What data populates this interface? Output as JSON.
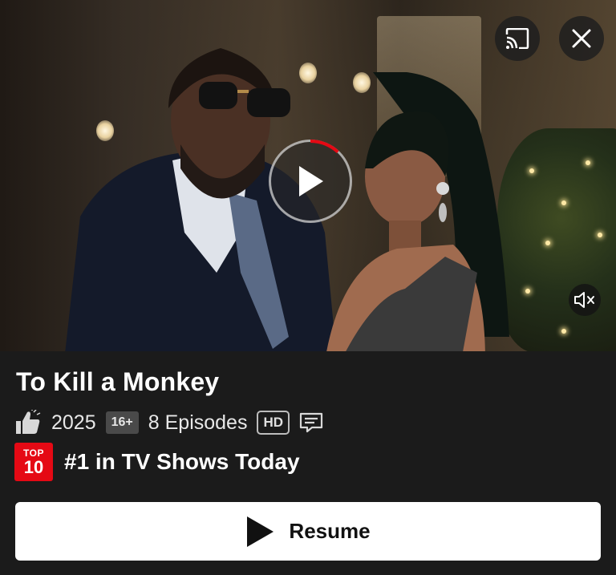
{
  "hero": {
    "description": "",
    "controls": {
      "cast_icon": "cast-icon",
      "close_icon": "close-icon",
      "play_icon": "play-icon",
      "mute_icon": "volume-muted-icon",
      "progress_fraction": 0.12
    }
  },
  "title": "To Kill a Monkey",
  "meta": {
    "like_icon": "thumbs-up-icon",
    "year": "2025",
    "maturity_rating": "16+",
    "episodes": "8 Episodes",
    "quality": "HD",
    "subtitles_icon": "subtitles-icon"
  },
  "top10": {
    "badge_top": "TOP",
    "badge_number": "10",
    "text": "#1 in TV Shows Today"
  },
  "resume_button": {
    "label": "Resume",
    "icon": "play-icon"
  },
  "colors": {
    "background": "#1b1b1b",
    "badge_red": "#e50914",
    "button_white": "#ffffff"
  }
}
